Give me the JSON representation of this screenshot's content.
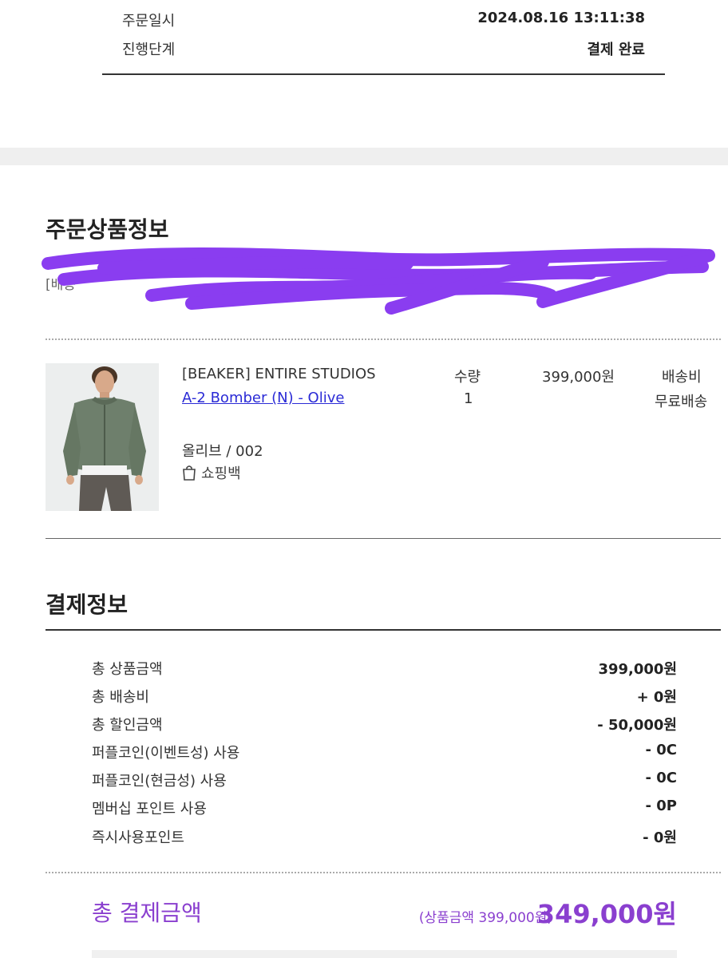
{
  "order_info": {
    "rows": [
      {
        "label": "주문일시",
        "value": "2024.08.16 13:11:38"
      },
      {
        "label": "진행단계",
        "value": "결제 완료"
      }
    ]
  },
  "product_section": {
    "title": "주문상품정보",
    "redacted_prefix": "[배송",
    "item": {
      "brand": "[BEAKER] ENTIRE STUDIOS",
      "name": "A-2 Bomber (N) - Olive",
      "option": "올리브 / 002",
      "bag_label": "쇼핑백",
      "qty_header": "수량",
      "qty_value": "1",
      "price": "399,000원",
      "shipping_header": "배송비",
      "shipping_value": "무료배송"
    }
  },
  "payment_section": {
    "title": "결제정보",
    "rows": [
      {
        "label": "총 상품금액",
        "value": "399,000원"
      },
      {
        "label": "총 배송비",
        "value": "+ 0원"
      },
      {
        "label": "총 할인금액",
        "value": "- 50,000원"
      },
      {
        "label": "퍼플코인(이벤트성) 사용",
        "value": "- 0C"
      },
      {
        "label": "퍼플코인(현금성) 사용",
        "value": "- 0C"
      },
      {
        "label": "멤버십 포인트 사용",
        "value": "- 0P"
      },
      {
        "label": "즉시사용포인트",
        "value": "- 0원"
      }
    ],
    "total_label": "총 결제금액",
    "total_sub": "(상품금액 399,000원)",
    "total_amount": "349,000원"
  },
  "colors": {
    "accent_purple": "#8a3fcf",
    "link_blue": "#2b2bd6",
    "redaction": "#8a3df0"
  },
  "icons": {
    "bag": "shopping-bag-icon"
  }
}
